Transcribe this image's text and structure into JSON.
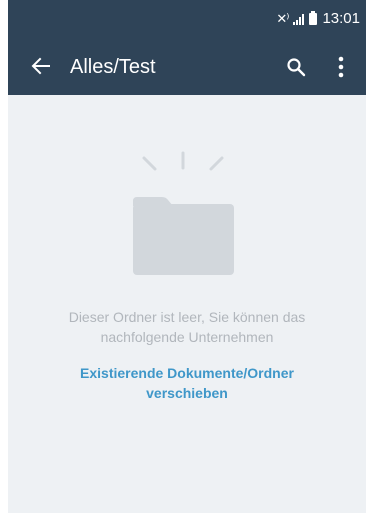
{
  "status_bar": {
    "time": "13:01",
    "icons": [
      "mute-icon",
      "signal-icon",
      "battery-icon"
    ]
  },
  "toolbar": {
    "title": "Alles/Test",
    "back_icon": "arrow-left-icon",
    "search_icon": "search-icon",
    "more_icon": "more-vertical-icon"
  },
  "empty_state": {
    "icon": "empty-folder-icon",
    "message": "Dieser Ordner ist leer, Sie können das nachfolgende Unternehmen",
    "action_label": "Existierende Dokumente/Ordner verschieben"
  },
  "colors": {
    "header": "#2f4458",
    "background": "#eef1f4",
    "accent": "#3f97c9",
    "muted_text": "#b1b6bc",
    "folder": "#d2d7dc"
  }
}
